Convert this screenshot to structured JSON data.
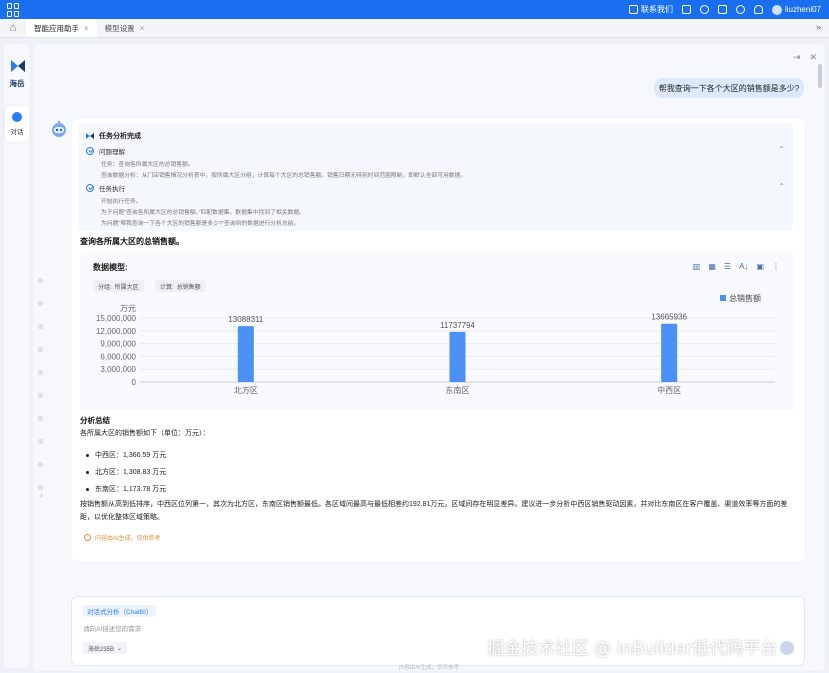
{
  "topbar": {
    "contact": "联系我们",
    "username": "liuzheni07"
  },
  "tabs": [
    {
      "label": "智能应用助手"
    },
    {
      "label": "模型设置"
    }
  ],
  "sidebar": {
    "brand": "海岳",
    "items": [
      {
        "label": "对话"
      }
    ]
  },
  "conversation": {
    "user_message": "帮我查询一下各个大区的销售额是多少?",
    "task": {
      "title": "任务分析完成",
      "steps": [
        {
          "label": "问题理解",
          "lines": [
            "任务：查询各所属大区的总销售额。",
            "查询数据分析：从门店销售情况分析表中，按所属大区分组，计算每个大区的总销售额。销售日期无特别时间范围限制，即默认全部可用数据。"
          ]
        },
        {
          "label": "任务执行",
          "lines": [
            "开始执行任务。",
            "为子问题“查询各所属大区的总销售额。”匹配数据集，数据集中找到了相关数据。",
            "为问题“帮我查询一下各个大区的销售额是多少?”查询到的数据进行分析总结。"
          ]
        }
      ]
    },
    "query_title": "查询各所属大区的总销售额。",
    "model_card": {
      "title": "数据模型:",
      "group_label": "分组:",
      "group_value": "所属大区",
      "calc_label": "计算:",
      "calc_value": "总销售额"
    },
    "summary": {
      "title": "分析总结",
      "intro": "各所属大区的销售额如下（单位：万元）：",
      "bullets": [
        "中西区：1,366.59 万元",
        "北方区：1,308.83 万元",
        "东南区：1,173.78 万元"
      ],
      "paragraph": "按销售额从高到低排序，中西区位列第一，其次为北方区，东南区销售额最低。各区域间最高与最低相差约192.81万元，区域间存在明显差异。建议进一步分析中西区销售驱动因素，并对比东南区在客户覆盖、渠道效率等方面的差距，以优化整体区域策略。",
      "ai_note": "内容由AI生成，仅供参考"
    }
  },
  "chart_data": {
    "type": "bar",
    "categories": [
      "北方区",
      "东南区",
      "中西区"
    ],
    "series": [
      {
        "name": "总销售额",
        "values": [
          13088311,
          11737794,
          13665936
        ]
      }
    ],
    "unit_label": "万元",
    "yticks": [
      "15,000,000",
      "12,000,000",
      "9,000,000",
      "6,000,000",
      "3,000,000",
      "0"
    ],
    "ylim": [
      0,
      15000000
    ],
    "legend_position": "top-right",
    "grid": true,
    "bar_color": "#4a90f5"
  },
  "input": {
    "mode": "对话式分析（ChatBI）",
    "placeholder": "请向AI描述您的需求",
    "model": "海岳235B",
    "footnote": "内容由AI生成，仅供参考"
  },
  "watermark": "掘金技术社区 @ inBuilder低代码平台"
}
